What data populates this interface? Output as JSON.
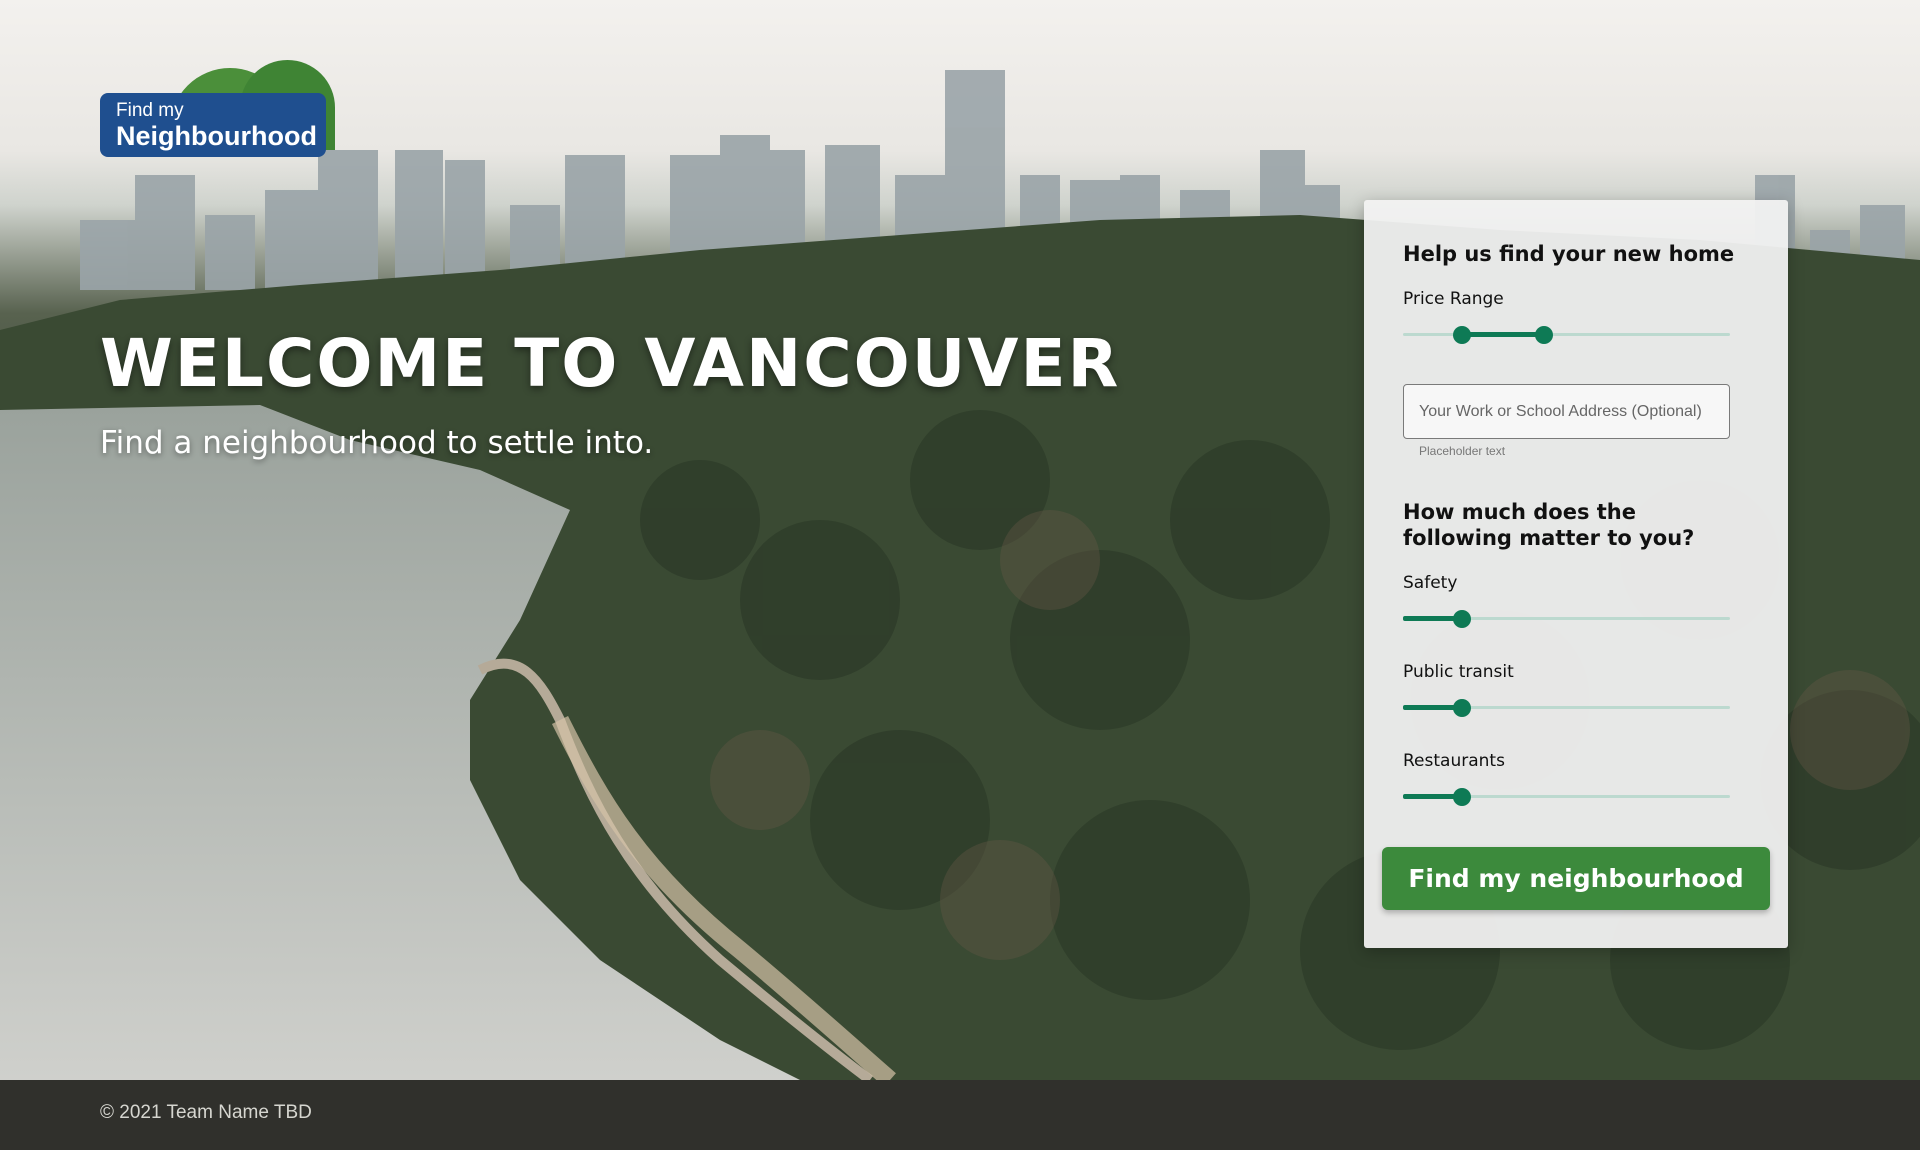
{
  "logo": {
    "line1": "Find my",
    "line2": "Neighbourhood"
  },
  "hero": {
    "title": "WELCOME TO VANCOUVER",
    "subtitle": "Find a neighbourhood to settle into."
  },
  "form": {
    "heading": "Help us find your new home",
    "price_range": {
      "label": "Price Range",
      "low": 0.18,
      "high": 0.43
    },
    "address": {
      "placeholder": "Your Work or School Address (Optional)",
      "value": "",
      "helper": "Placeholder text"
    },
    "question": "How much does the following matter to you?",
    "sliders": [
      {
        "label": "Safety",
        "value": 0.18
      },
      {
        "label": "Public transit",
        "value": 0.18
      },
      {
        "label": "Restaurants",
        "value": 0.18
      }
    ],
    "submit_label": "Find my neighbourhood"
  },
  "footer": {
    "copyright": "© 2021 Team Name TBD"
  },
  "colors": {
    "accent": "#0e7a55",
    "button": "#3c8a3c",
    "logo_plate": "#1f4f8f",
    "footer": "#30302c"
  }
}
